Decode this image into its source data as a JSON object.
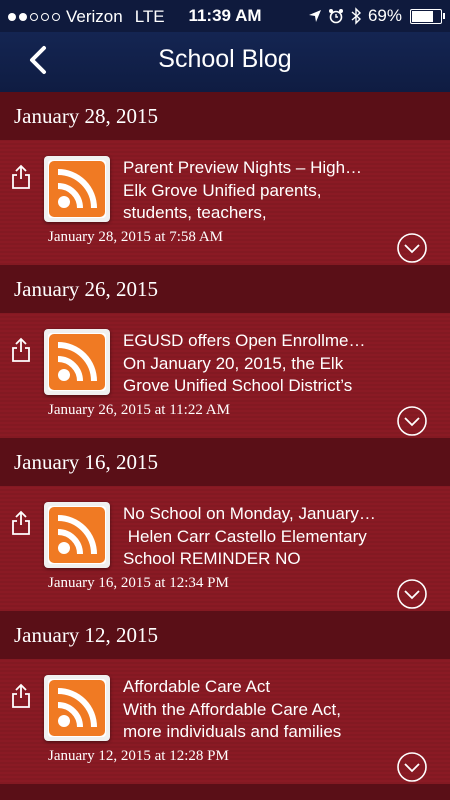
{
  "status_bar": {
    "carrier": "Verizon",
    "network": "LTE",
    "time": "11:39 AM",
    "battery": "69%",
    "signal_bars_filled": 2,
    "battery_level": 0.69
  },
  "nav": {
    "title": "School Blog",
    "back_icon": "chevron-left-icon"
  },
  "sections": [
    {
      "header": "January 28, 2015",
      "item": {
        "title": "Parent Preview Nights – High…",
        "desc_line1": "Elk Grove Unified parents,",
        "desc_line2": "students, teachers,",
        "date": "January 28, 2015 at 7:58 AM"
      }
    },
    {
      "header": "January 26, 2015",
      "item": {
        "title": "EGUSD offers Open Enrollme…",
        "desc_line1": "On January 20, 2015, the Elk",
        "desc_line2": "Grove Unified School District’s",
        "date": "January 26, 2015 at 11:22 AM"
      }
    },
    {
      "header": "January 16, 2015",
      "item": {
        "title": "No School on Monday, January…",
        "desc_line1": " Helen Carr Castello Elementary",
        "desc_line2": "School REMINDER NO",
        "date": "January 16, 2015 at 12:34 PM"
      }
    },
    {
      "header": "January 12, 2015",
      "item": {
        "title": "Affordable Care Act",
        "desc_line1": "With the Affordable Care Act,",
        "desc_line2": "more individuals and families",
        "date": "January 12, 2015 at 12:28 PM"
      }
    }
  ],
  "colors": {
    "nav_background": "#142552",
    "section_header": "#5a0f17",
    "item_background": "#8a1a24",
    "rss_orange": "#f07a23"
  }
}
